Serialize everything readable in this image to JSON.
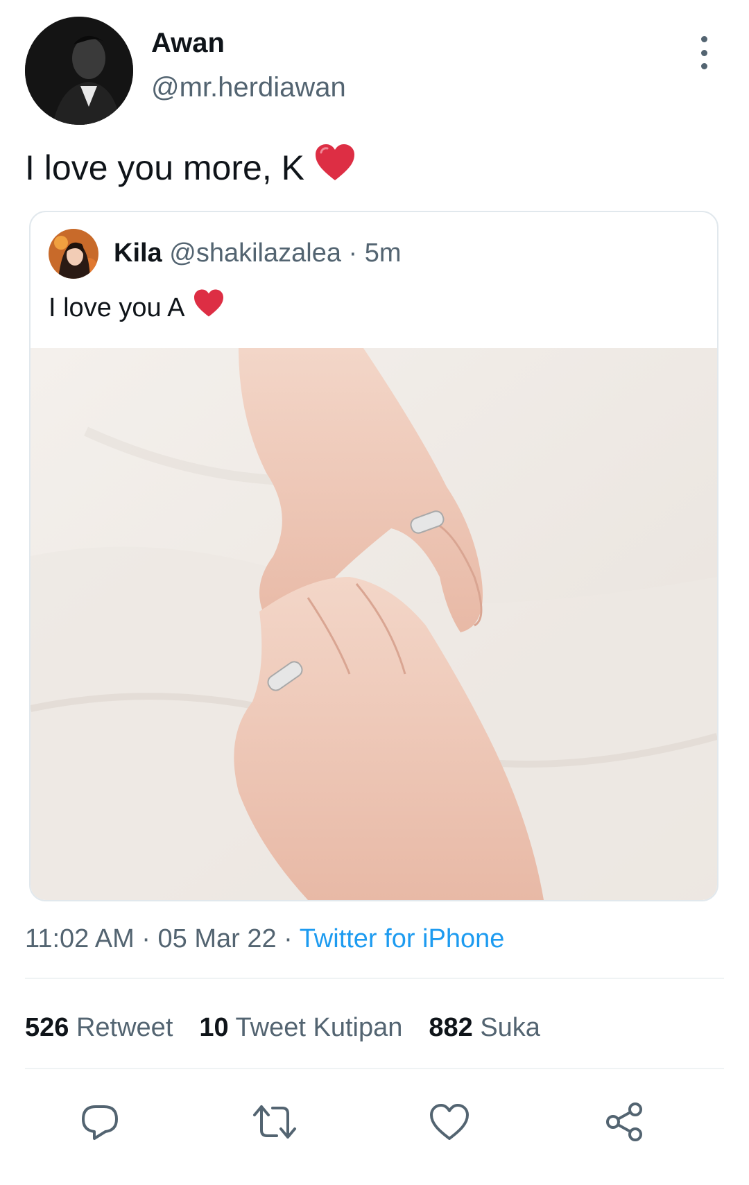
{
  "tweet": {
    "author": {
      "display_name": "Awan",
      "handle": "@mr.herdiawan",
      "avatar_icon": "profile-photo"
    },
    "text": "I love you more, K",
    "emoji": "❤",
    "timestamp": "11:02 AM · 05 Mar 22 ·",
    "source": "Twitter for iPhone"
  },
  "quoted_tweet": {
    "display_name": "Kila",
    "handle": "@shakilazalea",
    "separator": "·",
    "time": "5m",
    "text": "I love you A",
    "emoji": "❤",
    "image_icon": "photo-hands-rings"
  },
  "stats": [
    {
      "count": "526",
      "label": "Retweet"
    },
    {
      "count": "10",
      "label": "Tweet Kutipan"
    },
    {
      "count": "882",
      "label": "Suka"
    }
  ],
  "actions": [
    "reply-icon",
    "retweet-icon",
    "like-icon",
    "share-icon"
  ],
  "colors": {
    "accent": "#1d9bf0",
    "heart": "#dd2e44",
    "secondary_text": "#536471",
    "divider": "#eff3f4"
  }
}
